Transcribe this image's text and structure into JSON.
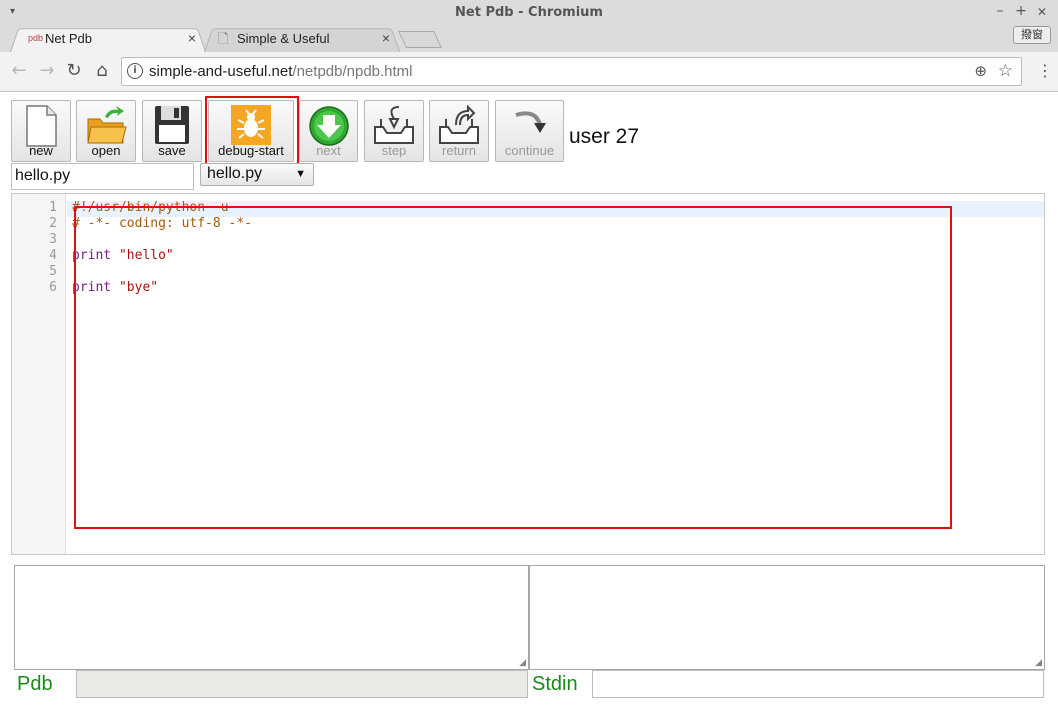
{
  "window": {
    "title": "Net Pdb - Chromium",
    "menu_arrow": "▾",
    "minimize": "–",
    "maximize": "+",
    "close": "✕"
  },
  "tabs": [
    {
      "label": "Net Pdb",
      "icon": "pdb-favicon",
      "icon_text": "pdb",
      "close": "×",
      "active": true
    },
    {
      "label": "Simple & Useful",
      "icon": "document-icon",
      "icon_text": "🗋",
      "close": "×",
      "active": false
    }
  ],
  "ime_button": "撥窗",
  "nav": {
    "back": "←",
    "forward": "→",
    "reload": "↻",
    "home": "⌂",
    "info": "i",
    "url_host": "simple-and-useful.net",
    "url_path": "/netpdb/npdb.html",
    "zoom": "⊕",
    "star": "☆",
    "menu": "⋮"
  },
  "toolbar": {
    "new": "new",
    "open": "open",
    "save": "save",
    "debug_start": "debug-start",
    "next": "next",
    "step": "step",
    "return": "return",
    "continue": "continue",
    "user_label": "user 27"
  },
  "file": {
    "name_value": "hello.py",
    "select_value": "hello.py",
    "select_arrow": "▼"
  },
  "editor": {
    "line_numbers": [
      "1",
      "2",
      "3",
      "4",
      "5",
      "6"
    ],
    "line1": "#!/usr/bin/python -u",
    "line2": "# -*- coding: utf-8 -*-",
    "line4_kw": "print",
    "line4_str": "\"hello\"",
    "line6_kw": "print",
    "line6_str": "\"bye\""
  },
  "bottom": {
    "pdb_label": "Pdb",
    "stdin_label": "Stdin",
    "pdb_input": "",
    "stdin_input": "",
    "resize_grip": "◢"
  },
  "colors": {
    "highlight": "#e01010",
    "label_green": "#1a8a1a",
    "debug_icon_bg": "#f5a623"
  }
}
